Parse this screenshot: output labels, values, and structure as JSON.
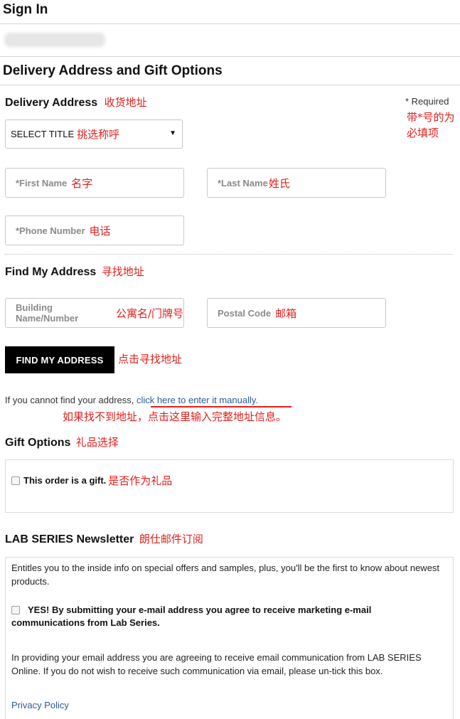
{
  "sign_in": {
    "title": "Sign In"
  },
  "delivery_section": {
    "title": "Delivery Address and Gift Options"
  },
  "delivery_address": {
    "label": "Delivery Address",
    "label_cn": "收货地址",
    "required_note": "* Required",
    "required_note_cn_line1": "带*号的为",
    "required_note_cn_line2": "必填项",
    "select_title": {
      "value": "SELECT TITLE",
      "annotation_cn": "挑选称呼"
    },
    "first_name": {
      "placeholder": "*First Name",
      "annotation_cn": "名字"
    },
    "last_name": {
      "placeholder": "*Last Name",
      "annotation_cn": "姓氏"
    },
    "phone": {
      "placeholder": "*Phone Number",
      "annotation_cn": "电话"
    }
  },
  "find_address": {
    "label": "Find My Address",
    "label_cn": "寻找地址",
    "building": {
      "placeholder": "Building Name/Number",
      "annotation_cn": "公寓名/门牌号"
    },
    "postal": {
      "placeholder": "Postal Code",
      "annotation_cn": "邮箱"
    },
    "button_label": "FIND MY ADDRESS",
    "button_annotation_cn": "点击寻找地址",
    "manual_prefix": "If you cannot find your address, ",
    "manual_link": "click here to enter it manually.",
    "manual_annotation_cn": "如果找不到地址，点击这里输入完整地址信息。"
  },
  "gift": {
    "label": "Gift Options",
    "label_cn": "礼品选择",
    "checkbox_label": "This order is a gift.",
    "checkbox_annotation_cn": "是否作为礼品"
  },
  "newsletter": {
    "label": "LAB SERIES Newsletter",
    "label_cn": "朗仕邮件订阅",
    "intro": "Entitles you to the inside info on special offers and samples, plus, you'll be the first to know about newest products.",
    "consent_line1": "YES! By submitting your e-mail address you agree to receive marketing e-mail",
    "consent_line2": "communications from Lab Series.",
    "disclaimer": "In providing your email address you are agreeing to receive email communication from LAB SERIES Online. If you do not wish to receive such communication via email, please un-tick this box.",
    "privacy_link": "Privacy Policy"
  },
  "colors": {
    "annotation": "#e0201c",
    "link": "#2b5a9c",
    "button_bg": "#000000",
    "underline": "#e0201c"
  }
}
